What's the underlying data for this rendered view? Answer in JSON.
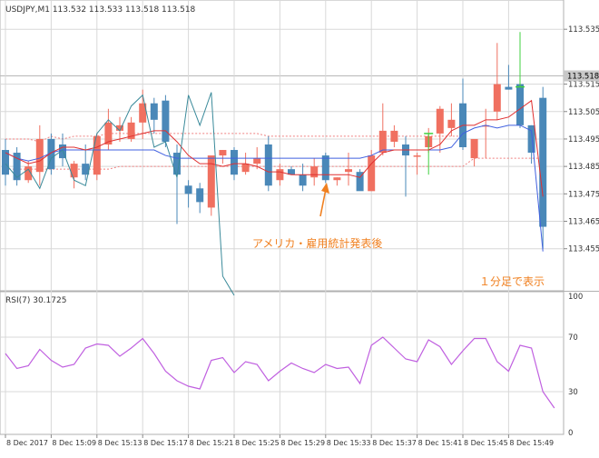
{
  "header": {
    "title": "USDJPY,M1  113.532 113.533 113.518 113.518",
    "rsi_label": "RSI(7) 30.1725"
  },
  "colors": {
    "bull": "#f07060",
    "bear": "#4a88b8",
    "grid": "#d8d8d8",
    "axis_text": "#333333",
    "blue_ma": "#4060e0",
    "red_ma": "#e03030",
    "teal_line": "#3a8a9a",
    "rsi_line": "#c060e0",
    "annotation": "#f08020",
    "price_tag_bg": "#c8c8c8",
    "signal_green": "#40d040"
  },
  "annotations": {
    "event_label": "アメリカ・雇用統計発表後",
    "timeframe_label": "１分足で表示"
  },
  "chart_data": [
    {
      "type": "candlestick",
      "price_axis": {
        "min": 113.44,
        "max": 113.545,
        "ticks": [
          "113.535",
          "113.515",
          "113.505",
          "113.495",
          "113.485",
          "113.475",
          "113.465",
          "113.455"
        ],
        "tick_values": [
          113.535,
          113.515,
          113.505,
          113.495,
          113.485,
          113.475,
          113.465,
          113.455
        ],
        "current_price_label": "113.518",
        "current_price": 113.518
      },
      "x_axis": {
        "labels": [
          "8 Dec 2017",
          "8 Dec 15:09",
          "8 Dec 15:13",
          "8 Dec 15:17",
          "8 Dec 15:21",
          "8 Dec 15:25",
          "8 Dec 15:29",
          "8 Dec 15:33",
          "8 Dec 15:37",
          "8 Dec 15:41",
          "8 Dec 15:45",
          "8 Dec 15:49"
        ],
        "label_index": [
          0,
          4,
          8,
          12,
          16,
          20,
          24,
          28,
          32,
          36,
          40,
          44
        ]
      },
      "candles": [
        {
          "o": 113.491,
          "h": 113.495,
          "l": 113.478,
          "c": 113.482
        },
        {
          "o": 113.49,
          "h": 113.492,
          "l": 113.478,
          "c": 113.48
        },
        {
          "o": 113.48,
          "h": 113.487,
          "l": 113.479,
          "c": 113.485
        },
        {
          "o": 113.483,
          "h": 113.5,
          "l": 113.478,
          "c": 113.495
        },
        {
          "o": 113.495,
          "h": 113.497,
          "l": 113.482,
          "c": 113.484
        },
        {
          "o": 113.493,
          "h": 113.497,
          "l": 113.485,
          "c": 113.488
        },
        {
          "o": 113.481,
          "h": 113.487,
          "l": 113.477,
          "c": 113.486
        },
        {
          "o": 113.486,
          "h": 113.493,
          "l": 113.48,
          "c": 113.482
        },
        {
          "o": 113.482,
          "h": 113.497,
          "l": 113.48,
          "c": 113.496
        },
        {
          "o": 113.493,
          "h": 113.506,
          "l": 113.491,
          "c": 113.501
        },
        {
          "o": 113.498,
          "h": 113.503,
          "l": 113.494,
          "c": 113.5
        },
        {
          "o": 113.495,
          "h": 113.503,
          "l": 113.494,
          "c": 113.501
        },
        {
          "o": 113.501,
          "h": 113.513,
          "l": 113.495,
          "c": 113.508
        },
        {
          "o": 113.508,
          "h": 113.51,
          "l": 113.497,
          "c": 113.502
        },
        {
          "o": 113.509,
          "h": 113.511,
          "l": 113.492,
          "c": 113.494
        },
        {
          "o": 113.49,
          "h": 113.493,
          "l": 113.464,
          "c": 113.482
        },
        {
          "o": 113.478,
          "h": 113.48,
          "l": 113.47,
          "c": 113.475
        },
        {
          "o": 113.477,
          "h": 113.479,
          "l": 113.468,
          "c": 113.472
        },
        {
          "o": 113.47,
          "h": 113.48,
          "l": 113.467,
          "c": 113.489
        },
        {
          "o": 113.489,
          "h": 113.491,
          "l": 113.486,
          "c": 113.491
        },
        {
          "o": 113.491,
          "h": 113.492,
          "l": 113.48,
          "c": 113.482
        },
        {
          "o": 113.483,
          "h": 113.49,
          "l": 113.482,
          "c": 113.486
        },
        {
          "o": 113.486,
          "h": 113.492,
          "l": 113.484,
          "c": 113.488
        },
        {
          "o": 113.493,
          "h": 113.496,
          "l": 113.476,
          "c": 113.478
        },
        {
          "o": 113.48,
          "h": 113.486,
          "l": 113.478,
          "c": 113.484
        },
        {
          "o": 113.484,
          "h": 113.485,
          "l": 113.482,
          "c": 113.482
        },
        {
          "o": 113.482,
          "h": 113.486,
          "l": 113.476,
          "c": 113.478
        },
        {
          "o": 113.481,
          "h": 113.488,
          "l": 113.478,
          "c": 113.485
        },
        {
          "o": 113.489,
          "h": 113.49,
          "l": 113.479,
          "c": 113.48
        },
        {
          "o": 113.48,
          "h": 113.481,
          "l": 113.478,
          "c": 113.481
        },
        {
          "o": 113.483,
          "h": 113.49,
          "l": 113.478,
          "c": 113.484
        },
        {
          "o": 113.483,
          "h": 113.484,
          "l": 113.477,
          "c": 113.476
        },
        {
          "o": 113.476,
          "h": 113.491,
          "l": 113.476,
          "c": 113.489
        },
        {
          "o": 113.49,
          "h": 113.508,
          "l": 113.489,
          "c": 113.498
        },
        {
          "o": 113.494,
          "h": 113.5,
          "l": 113.492,
          "c": 113.498
        },
        {
          "o": 113.493,
          "h": 113.496,
          "l": 113.474,
          "c": 113.489
        },
        {
          "o": 113.489,
          "h": 113.49,
          "l": 113.482,
          "c": 113.489
        },
        {
          "o": 113.492,
          "h": 113.499,
          "l": 113.49,
          "c": 113.496
        },
        {
          "o": 113.497,
          "h": 113.507,
          "l": 113.49,
          "c": 113.506
        },
        {
          "o": 113.499,
          "h": 113.508,
          "l": 113.496,
          "c": 113.502
        },
        {
          "o": 113.508,
          "h": 113.517,
          "l": 113.491,
          "c": 113.492
        },
        {
          "o": 113.488,
          "h": 113.493,
          "l": 113.485,
          "c": 113.495
        },
        {
          "o": 113.5,
          "h": 113.506,
          "l": 113.488,
          "c": 113.5
        },
        {
          "o": 113.505,
          "h": 113.53,
          "l": 113.502,
          "c": 113.515
        },
        {
          "o": 113.514,
          "h": 113.522,
          "l": 113.513,
          "c": 113.513
        },
        {
          "o": 113.515,
          "h": 113.518,
          "l": 113.499,
          "c": 113.5
        },
        {
          "o": 113.5,
          "h": 113.5,
          "l": 113.486,
          "c": 113.49
        },
        {
          "o": 113.51,
          "h": 113.514,
          "l": 113.455,
          "c": 113.463
        }
      ],
      "signals": [
        {
          "index": 37,
          "value": 113.497,
          "low": 113.482
        },
        {
          "index": 45,
          "value": 113.514,
          "high": 113.534
        }
      ],
      "series": [
        {
          "style": "blue_ma",
          "values": [
            113.49,
            113.488,
            113.487,
            113.488,
            113.49,
            113.491,
            113.491,
            113.491,
            113.491,
            113.491,
            113.491,
            113.491,
            113.491,
            113.491,
            113.489,
            113.488,
            113.488,
            113.488,
            113.488,
            113.488,
            113.488,
            113.488,
            113.488,
            113.488,
            113.488,
            113.488,
            113.488,
            113.488,
            113.488,
            113.488,
            113.488,
            113.488,
            113.489,
            113.491,
            113.491,
            113.491,
            113.491,
            113.491,
            113.491,
            113.492,
            113.497,
            113.499,
            113.5,
            113.499,
            113.5,
            113.5,
            113.498,
            113.454
          ]
        },
        {
          "style": "red_ma",
          "values": [
            113.49,
            113.488,
            113.486,
            113.487,
            113.49,
            113.492,
            113.492,
            113.491,
            113.492,
            113.494,
            113.495,
            113.496,
            113.497,
            113.498,
            113.498,
            113.494,
            113.489,
            113.486,
            113.486,
            113.485,
            113.486,
            113.486,
            113.485,
            113.483,
            113.483,
            113.482,
            113.482,
            113.482,
            113.482,
            113.482,
            113.482,
            113.481,
            113.486,
            113.49,
            113.491,
            113.491,
            113.491,
            113.491,
            113.493,
            113.498,
            113.5,
            113.5,
            113.502,
            113.502,
            113.503,
            113.506,
            113.509,
            113.474
          ]
        },
        {
          "style": "teal_line",
          "values": [
            113.486,
            113.481,
            113.484,
            113.477,
            113.488,
            113.491,
            113.48,
            113.478,
            113.497,
            113.502,
            113.498,
            113.507,
            113.511,
            113.492,
            113.494,
            113.481,
            113.511,
            113.5,
            113.512,
            113.445,
            113.438
          ]
        }
      ],
      "envelope": {
        "upper": [
          113.495,
          113.495,
          113.495,
          113.494,
          113.496,
          113.495,
          113.496,
          113.496,
          113.496,
          113.497,
          113.497,
          113.497,
          113.497,
          113.497,
          113.497,
          113.497,
          113.497,
          113.497,
          113.497,
          113.497,
          113.497,
          113.497,
          113.497,
          113.496,
          113.496,
          113.496,
          113.496,
          113.496,
          113.496,
          113.496,
          113.496,
          113.496,
          113.496,
          113.496,
          113.496,
          113.496,
          113.496,
          113.496,
          113.496,
          113.496,
          113.496
        ],
        "lower": [
          113.484,
          113.484,
          113.484,
          113.484,
          113.484,
          113.484,
          113.484,
          113.484,
          113.484,
          113.484,
          113.485,
          113.485,
          113.485,
          113.485,
          113.485,
          113.485,
          113.485,
          113.485,
          113.485,
          113.485,
          113.485,
          113.485,
          113.485,
          113.485,
          113.485,
          113.485,
          113.485,
          113.485,
          113.485,
          113.485,
          113.485,
          113.485,
          113.485,
          113.485,
          113.485,
          113.485,
          113.485,
          113.485,
          113.485,
          113.485,
          113.485,
          113.488,
          113.488,
          113.488,
          113.488,
          113.488,
          113.488,
          113.488
        ]
      }
    },
    {
      "type": "line",
      "series": [
        {
          "style": "rsi_line",
          "values": [
            58,
            47,
            49,
            61,
            53,
            48,
            50,
            62,
            65,
            64,
            56,
            62,
            69,
            58,
            45,
            38,
            34,
            32,
            53,
            55,
            44,
            52,
            50,
            38,
            45,
            51,
            47,
            44,
            50,
            47,
            48,
            36,
            64,
            70,
            62,
            54,
            52,
            68,
            63,
            50,
            60,
            69,
            69,
            52,
            45,
            64,
            62,
            30,
            18
          ]
        }
      ],
      "ylim": [
        0,
        100
      ],
      "y_ticks": [
        "100",
        "70",
        "30",
        "0"
      ],
      "y_tick_values": [
        100,
        70,
        30,
        0
      ],
      "levels": [
        70,
        30
      ]
    }
  ]
}
